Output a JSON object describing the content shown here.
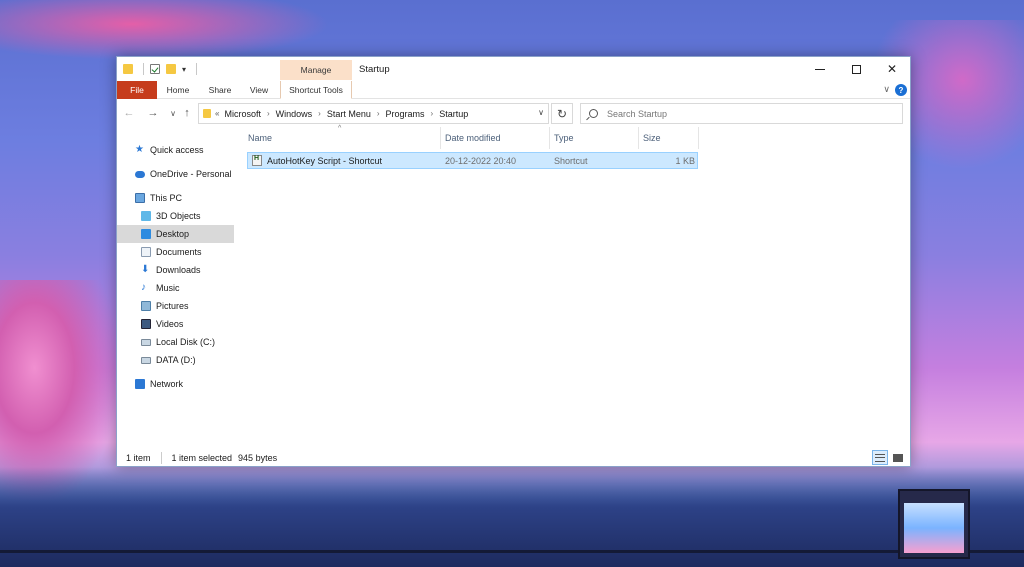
{
  "window": {
    "title": "Startup",
    "manage_tab": "Manage"
  },
  "ribbon": {
    "tabs": [
      "File",
      "Home",
      "Share",
      "View",
      "Shortcut Tools"
    ],
    "help": "?"
  },
  "navigation": {
    "breadcrumb_overflow": "«",
    "breadcrumb": [
      "Microsoft",
      "Windows",
      "Start Menu",
      "Programs",
      "Startup"
    ],
    "search_placeholder": "Search Startup"
  },
  "sidebar": {
    "items": [
      {
        "label": "Quick access",
        "icon": "star-icon"
      },
      {
        "label": "OneDrive - Personal",
        "icon": "cloud-icon"
      },
      {
        "label": "This PC",
        "icon": "computer-icon"
      },
      {
        "label": "3D Objects",
        "icon": "cube-icon"
      },
      {
        "label": "Desktop",
        "icon": "desktop-icon",
        "selected": true
      },
      {
        "label": "Documents",
        "icon": "document-icon"
      },
      {
        "label": "Downloads",
        "icon": "download-icon"
      },
      {
        "label": "Music",
        "icon": "music-icon"
      },
      {
        "label": "Pictures",
        "icon": "picture-icon"
      },
      {
        "label": "Videos",
        "icon": "video-icon"
      },
      {
        "label": "Local Disk (C:)",
        "icon": "disk-icon"
      },
      {
        "label": "DATA (D:)",
        "icon": "disk-icon"
      },
      {
        "label": "Network",
        "icon": "network-icon"
      }
    ]
  },
  "file_list": {
    "columns": [
      "Name",
      "Date modified",
      "Type",
      "Size"
    ],
    "rows": [
      {
        "name": "AutoHotKey Script - Shortcut",
        "date": "20-12-2022 20:40",
        "type": "Shortcut",
        "size": "1 KB",
        "selected": true
      }
    ]
  },
  "status": {
    "count": "1 item",
    "selected": "1 item selected",
    "size": "945 bytes"
  },
  "colors": {
    "file_tab": "#c63c1c",
    "manage_tab": "#fbe0c9",
    "selection": "#cce8ff",
    "accent": "#1a6fd4"
  }
}
